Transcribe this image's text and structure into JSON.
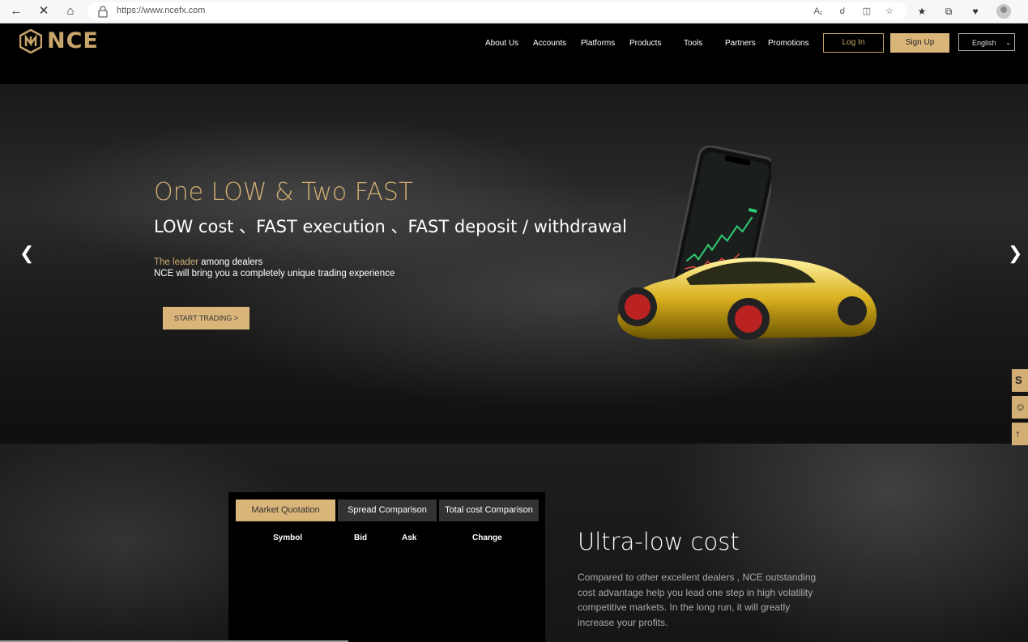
{
  "browser": {
    "url": "https://www.ncefx.com",
    "icons": [
      "back-icon",
      "stop-icon",
      "home-icon",
      "lock-icon",
      "read-aloud-icon",
      "zoom-icon",
      "split-screen-icon",
      "favorite-icon",
      "favorites-icon",
      "collections-icon",
      "extensions-icon",
      "profile-icon"
    ]
  },
  "header": {
    "logo_text": "NCE",
    "menu": [
      "About Us",
      "Accounts",
      "Platforms",
      "Products",
      "Tools",
      "Partners",
      "Promotions"
    ],
    "login": "Log In",
    "signup": "Sign Up",
    "language": "English"
  },
  "hero": {
    "title": "One LOW & Two FAST",
    "subtitle": "LOW cost 、FAST execution 、FAST deposit / withdrawal",
    "line1_highlight": "The leader",
    "line1_rest": " among dealers",
    "line2": "NCE will bring you a completely unique trading experience",
    "cta": "START TRADING >"
  },
  "quotes": {
    "tabs": [
      "Market Quotation",
      "Spread Comparison",
      "Total cost Comparison"
    ],
    "active_tab": 0,
    "columns": [
      "Symbol",
      "Bid",
      "Ask",
      "Change"
    ]
  },
  "cost": {
    "title": "Ultra-low cost",
    "body": "Compared to other excellent dealers , NCE outstanding cost advantage help you lead one step in high volatility competitive markets. In the long run, it will greatly increase your profits."
  },
  "side_widgets": [
    "skype-icon",
    "customer-service-icon",
    "back-to-top-icon"
  ],
  "colors": {
    "gold": "#d2ae74",
    "gold_button": "#d9b57a",
    "background": "#000000"
  }
}
